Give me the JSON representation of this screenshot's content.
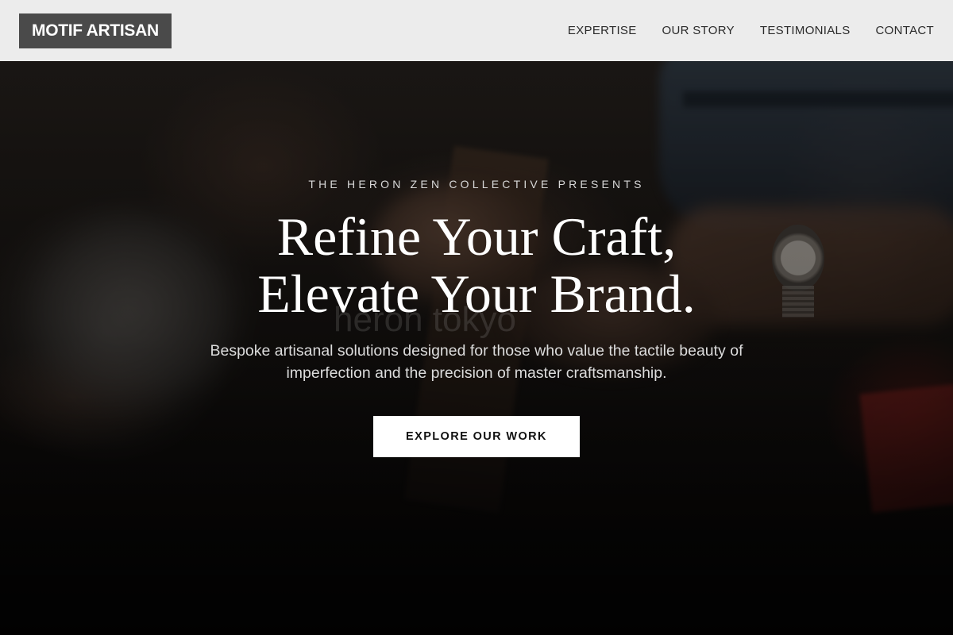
{
  "header": {
    "logo_text": "MOTIF ARTISAN",
    "nav": [
      {
        "label": "EXPERTISE"
      },
      {
        "label": "OUR STORY"
      },
      {
        "label": "TESTIMONIALS"
      },
      {
        "label": "CONTACT"
      }
    ]
  },
  "hero": {
    "eyebrow": "THE HERON ZEN COLLECTIVE PRESENTS",
    "headline_line1": "Refine Your Craft,",
    "headline_line2": "Elevate Your Brand.",
    "watermark": "heron tokyo",
    "subtext": "Bespoke artisanal solutions designed for those who value the tactile beauty of imperfection and the precision of master craftsmanship.",
    "cta_label": "EXPLORE OUR WORK"
  },
  "colors": {
    "header_bg": "#ececec",
    "logo_bg": "#4a4a4a",
    "cta_bg": "#ffffff",
    "text_light": "#ffffff"
  }
}
